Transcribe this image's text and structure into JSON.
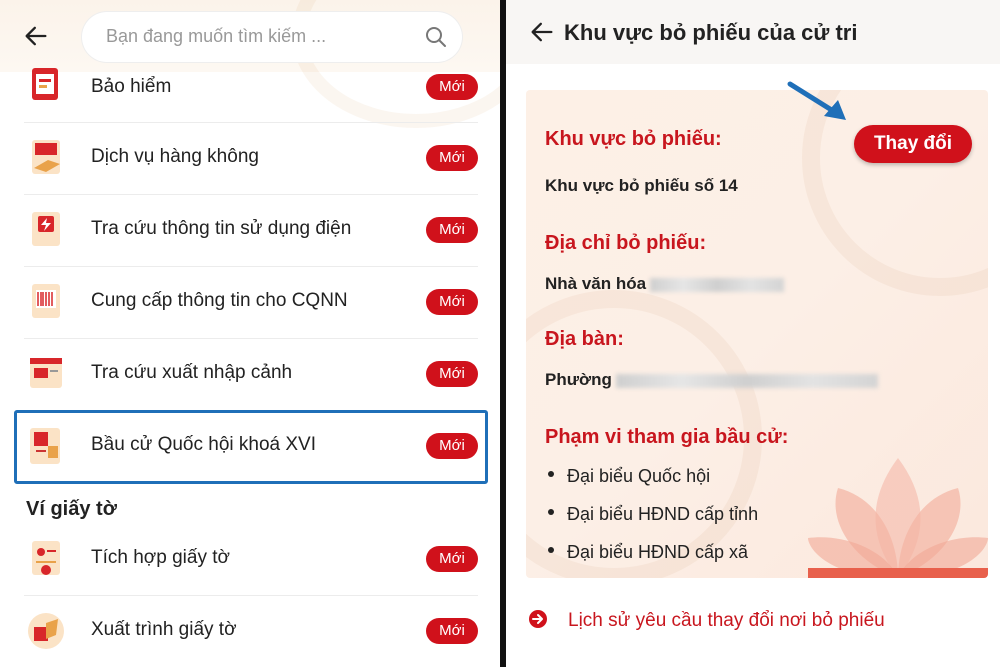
{
  "left": {
    "search_placeholder": "Bạn đang muốn tìm kiếm ...",
    "items": [
      {
        "label": "Bảo hiểm",
        "badge": "Mới",
        "icon": "insurance-icon"
      },
      {
        "label": "Dịch vụ hàng không",
        "badge": "Mới",
        "icon": "aviation-service-icon"
      },
      {
        "label": "Tra cứu thông tin sử dụng điện",
        "badge": "Mới",
        "icon": "electricity-icon"
      },
      {
        "label": "Cung cấp thông tin cho CQNN",
        "badge": "Mới",
        "icon": "barcode-document-icon"
      },
      {
        "label": "Tra cứu xuất nhập cảnh",
        "badge": "Mới",
        "icon": "immigration-icon"
      },
      {
        "label": "Bầu cử Quốc hội khoá XVI",
        "badge": "Mới",
        "icon": "election-icon"
      }
    ],
    "section_title": "Ví giấy tờ",
    "wallet_items": [
      {
        "label": "Tích hợp giấy tờ",
        "badge": "Mới",
        "icon": "document-integration-icon"
      },
      {
        "label": "Xuất trình giấy tờ",
        "badge": "Mới",
        "icon": "present-document-icon"
      }
    ]
  },
  "right": {
    "title": "Khu vực bỏ phiếu của cử tri",
    "polling_area_label": "Khu vực bỏ phiếu:",
    "polling_area_value": "Khu vực bỏ phiếu số 14",
    "change_button": "Thay đổi",
    "address_label": "Địa chỉ bỏ phiếu:",
    "address_value": "Nhà văn hóa",
    "locality_label": "Địa bàn:",
    "locality_value": "Phường",
    "scope_label": "Phạm vi tham gia bầu cử:",
    "scope_items": [
      "Đại biểu Quốc hội",
      "Đại biểu HĐND cấp tỉnh",
      "Đại biểu HĐND cấp xã"
    ],
    "history_link": "Lịch sử yêu cầu thay đổi nơi bỏ phiếu"
  },
  "colors": {
    "accent_red": "#d0111b",
    "highlight_blue": "#1f6fb8"
  }
}
